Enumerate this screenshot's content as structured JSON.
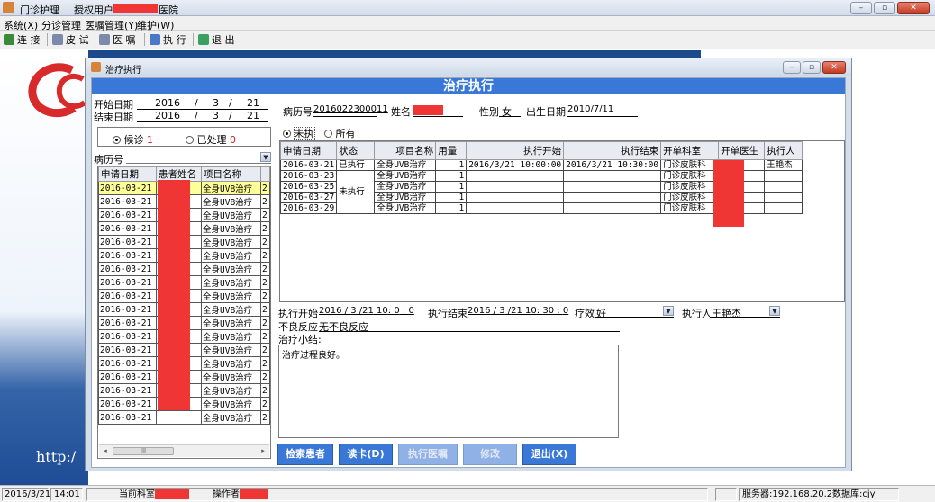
{
  "app": {
    "title": "门诊护理",
    "license_label": "授权用户:",
    "license_suffix": "医院"
  },
  "window_controls": {
    "minimize": "–",
    "maximize": "▫",
    "close": "✕"
  },
  "menu": [
    "系统(X)",
    "分诊管理",
    "医嘱管理(Y)",
    "维护(W)"
  ],
  "toolbar": [
    "连 接",
    "皮 试",
    "医 嘱",
    "执 行",
    "退 出"
  ],
  "background": {
    "url_text": "http:/"
  },
  "dialog": {
    "window_title": "治疗执行",
    "header": "治疗执行",
    "start_date_label": "开始日期",
    "end_date_label": "结束日期",
    "start_date": {
      "year": "2016",
      "month": "3",
      "day": "21"
    },
    "end_date": {
      "year": "2016",
      "month": "3",
      "day": "21"
    },
    "date_sep": "/",
    "waiting_label": "候诊",
    "waiting_count": "1",
    "processed_label": "已处理",
    "processed_count": "0",
    "record_no_label": "病历号",
    "left_table": {
      "headers": [
        "申请日期",
        "患者姓名",
        "项目名称",
        ""
      ],
      "rows": [
        [
          "2016-03-21",
          "",
          "全身UVB治疗",
          "2"
        ],
        [
          "2016-03-21",
          "",
          "全身UVB治疗",
          "2"
        ],
        [
          "2016-03-21",
          "",
          "全身UVB治疗",
          "2"
        ],
        [
          "2016-03-21",
          "",
          "全身UVB治疗",
          "2"
        ],
        [
          "2016-03-21",
          "",
          "全身UVB治疗",
          "2"
        ],
        [
          "2016-03-21",
          "",
          "全身UVB治疗",
          "2"
        ],
        [
          "2016-03-21",
          "",
          "全身UVB治疗",
          "2"
        ],
        [
          "2016-03-21",
          "",
          "全身UVB治疗",
          "2"
        ],
        [
          "2016-03-21",
          "",
          "全身UVB治疗",
          "2"
        ],
        [
          "2016-03-21",
          "",
          "全身UVB治疗",
          "2"
        ],
        [
          "2016-03-21",
          "",
          "全身UVB治疗",
          "2"
        ],
        [
          "2016-03-21",
          "",
          "全身UVB治疗",
          "2"
        ],
        [
          "2016-03-21",
          "",
          "全身UVB治疗",
          "2"
        ],
        [
          "2016-03-21",
          "",
          "全身UVB治疗",
          "2"
        ],
        [
          "2016-03-21",
          "",
          "全身UVB治疗",
          "2"
        ],
        [
          "2016-03-21",
          "",
          "全身UVB治疗",
          "2"
        ],
        [
          "2016-03-21",
          "",
          "全身UVB治疗",
          "2"
        ],
        [
          "2016-03-21",
          "",
          "全身UVB治疗",
          "2"
        ]
      ],
      "scroll_grip": "III"
    },
    "patient": {
      "record_no_label": "病历号",
      "record_no": "2016022300011",
      "name_label": "姓名",
      "sex_label": "性别",
      "sex": "女",
      "birth_label": "出生日期",
      "birth": "2010/7/11"
    },
    "filter_unexec": "未执",
    "filter_all": "所有",
    "right_table": {
      "headers": [
        "申请日期",
        "状态",
        "项目名称",
        "用量",
        "执行开始",
        "执行结束",
        "开单科室",
        "开单医生",
        "执行人"
      ],
      "rows": [
        [
          "2016-03-21",
          "已执行",
          "全身UVB治疗",
          "1",
          "2016/3/21 10:00:00",
          "2016/3/21 10:30:00",
          "门诊皮肤科",
          "",
          "王艳杰"
        ],
        [
          "2016-03-23",
          "",
          "全身UVB治疗",
          "1",
          "",
          "",
          "门诊皮肤科",
          "",
          ""
        ],
        [
          "2016-03-25",
          "未执行",
          "全身UVB治疗",
          "1",
          "",
          "",
          "门诊皮肤科",
          "",
          ""
        ],
        [
          "2016-03-27",
          "",
          "全身UVB治疗",
          "1",
          "",
          "",
          "门诊皮肤科",
          "",
          ""
        ],
        [
          "2016-03-29",
          "",
          "全身UVB治疗",
          "1",
          "",
          "",
          "门诊皮肤科",
          "",
          ""
        ]
      ]
    },
    "exec": {
      "start_label": "执行开始",
      "start": {
        "y": "2016",
        "m": "3",
        "d": "21",
        "h": "10",
        "mi": "0",
        "s": "0"
      },
      "end_label": "执行结束",
      "end": {
        "y": "2016",
        "m": "3",
        "d": "21",
        "h": "10",
        "mi": "30",
        "s": "0"
      },
      "effect_label": "疗效",
      "effect": "好",
      "executor_label": "执行人",
      "executor": "王艳杰",
      "adverse_label": "不良反应",
      "adverse": "无不良反应",
      "summary_label": "治疗小结:",
      "summary": "治疗过程良好。"
    },
    "buttons": [
      "检索患者",
      "读卡(D)",
      "执行医嘱",
      "修改",
      "退出(X)"
    ]
  },
  "statusbar": {
    "date": "2016/3/21",
    "time": "14:01",
    "dept_label": "当前科室:",
    "operator_label": "操作者",
    "server_label": "服务器:",
    "server": "192.168.20.2",
    "db_label": "数据库:",
    "db": "cjy"
  }
}
